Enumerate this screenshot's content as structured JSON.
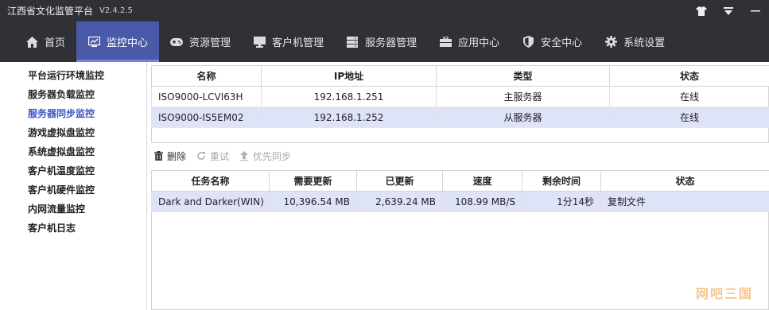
{
  "window": {
    "title": "江西省文化监管平台",
    "version": "V2.4.2.5"
  },
  "nav": {
    "items": [
      {
        "label": "首页",
        "icon": "home-icon"
      },
      {
        "label": "监控中心",
        "icon": "chart-icon",
        "active": true
      },
      {
        "label": "资源管理",
        "icon": "gamepad-icon"
      },
      {
        "label": "客户机管理",
        "icon": "monitor-icon"
      },
      {
        "label": "服务器管理",
        "icon": "server-icon"
      },
      {
        "label": "应用中心",
        "icon": "briefcase-icon"
      },
      {
        "label": "安全中心",
        "icon": "shield-icon"
      },
      {
        "label": "系统设置",
        "icon": "gear-icon"
      }
    ]
  },
  "sidebar": {
    "items": [
      {
        "label": "平台运行环境监控"
      },
      {
        "label": "服务器负载监控"
      },
      {
        "label": "服务器同步监控",
        "active": true
      },
      {
        "label": "游戏虚拟盘监控"
      },
      {
        "label": "系统虚拟盘监控"
      },
      {
        "label": "客户机温度监控"
      },
      {
        "label": "客户机硬件监控"
      },
      {
        "label": "内网流量监控"
      },
      {
        "label": "客户机日志"
      }
    ]
  },
  "servers": {
    "columns": [
      "名称",
      "IP地址",
      "类型",
      "状态"
    ],
    "rows": [
      {
        "name": "ISO9000-LCVI63H",
        "ip": "192.168.1.251",
        "type": "主服务器",
        "status": "在线"
      },
      {
        "name": "ISO9000-IS5EM02",
        "ip": "192.168.1.252",
        "type": "从服务器",
        "status": "在线",
        "selected": true
      }
    ]
  },
  "toolbar": {
    "delete_label": "删除",
    "retry_label": "重试",
    "priority_label": "优先同步"
  },
  "tasks": {
    "columns": [
      "任务名称",
      "需要更新",
      "已更新",
      "速度",
      "剩余时间",
      "状态"
    ],
    "rows": [
      {
        "name": "Dark and Darker(WIN)",
        "need": "10,396.54 MB",
        "done": "2,639.24 MB",
        "speed": "108.99 MB/S",
        "remaining": "1分14秒",
        "status": "复制文件",
        "selected": true
      }
    ]
  },
  "watermark": "网吧三国",
  "colors": {
    "titlebar": "#2f3136",
    "nav_active": "#4a5aa8",
    "sidebar_active_text": "#3c52c4",
    "row_selected": "#dfe3f8"
  }
}
